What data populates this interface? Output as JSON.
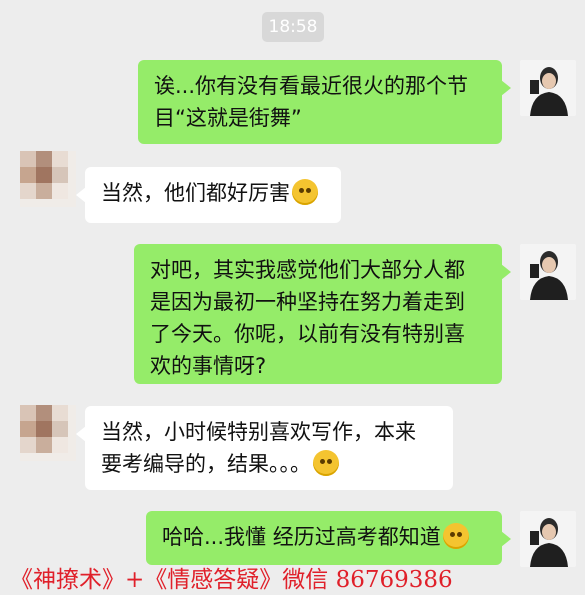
{
  "chat": {
    "time": "18:58",
    "messages": [
      {
        "side": "me",
        "lines": [
          "诶...你有没有看最近很火的那个节",
          "目“这就是街舞”"
        ]
      },
      {
        "side": "other",
        "lines": [
          "当然，他们都好厉害"
        ],
        "emoji": "dizzy-face"
      },
      {
        "side": "me",
        "lines": [
          "对吧，其实我感觉他们大部分人都",
          "是因为最初一种坚持在努力着走到",
          "了今天。你呢，以前有没有特别喜",
          "欢的事情呀?"
        ]
      },
      {
        "side": "other",
        "lines": [
          "当然，小时候特别喜欢写作，本来",
          "要考编导的，结果。。。"
        ],
        "emoji": "laughing-face"
      },
      {
        "side": "me",
        "lines": [
          "哈哈...我懂 经历过高考都知道"
        ],
        "emoji": "smirk-face"
      }
    ]
  },
  "watermark": {
    "text": "《神撩术》+《情感答疑》微信 86769386",
    "color": "#e0202a"
  }
}
